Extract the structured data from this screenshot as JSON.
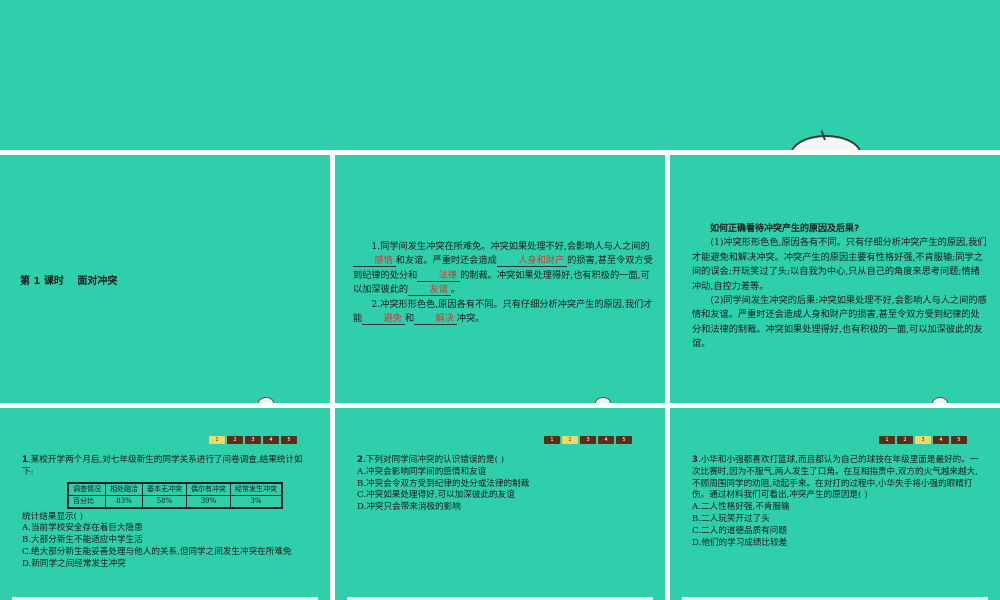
{
  "slide1": {
    "lesson": "第 1 课时",
    "title": "面对冲突"
  },
  "slide2": {
    "p1": {
      "a": "1.同学间发生冲突在所难免。冲突如果处理不好,会影响人与人之间的",
      "b1": "感情",
      "c": "和友谊。严重时还会造成",
      "b2": "人身和财产",
      "d": "的损害,甚至令双方受到纪律的处分和",
      "b3": "法律",
      "e": "的制裁。冲突如果处理得好,也有积极的一面,可以加深彼此的",
      "b4": "友谊",
      "f": "。"
    },
    "p2": {
      "a": "2.冲突形形色色,原因各有不同。只有仔细分析冲突产生的原因,我们才能",
      "b1": "避免",
      "c": "和",
      "b2": "解决",
      "d": "冲突。"
    }
  },
  "slide3": {
    "heading": "如何正确看待冲突产生的原因及后果?",
    "p1": "(1)冲突形形色色,原因各有不同。只有仔细分析冲突产生的原因,我们才能避免和解决冲突。冲突产生的原因主要有性格好强,不肯服输;同学之间的误会;开玩笑过了头;以自我为中心,只从自己的角度来思考问题;情绪冲动,自控力差等。",
    "p2": "(2)同学间发生冲突的后果:冲突如果处理不好,会影响人与人之间的感情和友谊。严重时还会造成人身和财产的损害,甚至令双方受到纪律的处分和法律的制裁。冲突如果处理得好,也有积极的一面,可以加深彼此的友谊。"
  },
  "pager": {
    "labels": [
      "1",
      "2",
      "3",
      "4",
      "5"
    ]
  },
  "q1": {
    "stem_num": "1",
    "stem": ".某校开学两个月后,对七年级新生的同学关系进行了问卷调查,结果统计如下:",
    "table": {
      "header": [
        "调查情况",
        "相处融洽",
        "基本无冲突",
        "偶尔有冲突",
        "经常发生冲突"
      ],
      "row": [
        "百分比",
        "83%",
        "58%",
        "39%",
        "3%"
      ]
    },
    "stem2": "统计结果显示(    )",
    "options": [
      "A.当前学校安全存在着巨大隐患",
      "B.大部分新生不能适应中学生活",
      "C.绝大部分新生能妥善处理与他人的关系,但同学之间发生冲突在所难免",
      "D.新同学之间经常发生冲突"
    ]
  },
  "q2": {
    "stem_num": "2",
    "stem": ".下列对同学间冲突的认识错误的是(    )",
    "options": [
      "A.冲突会影响同学间的感情和友谊",
      "B.冲突会令双方受到纪律的处分或法律的制裁",
      "C.冲突如果处理得好,可以加深彼此的友谊",
      "D.冲突只会带来消极的影响"
    ]
  },
  "q3": {
    "stem_num": "3",
    "stem": ".小华和小强都喜欢打篮球,而且都认为自己的球技在年级里面是最好的。一次比赛时,因为不服气,两人发生了口角。在互相指责中,双方的火气越来越大,不顾周围同学的劝阻,动起手来。在对打的过程中,小华失手将小强的眼睛打伤。通过材料我们可看出,冲突产生的原因是(    )",
    "options": [
      "A.二人性格好强,不肯服输",
      "B.二人玩笑开过了头",
      "C.二人的道德品质有问题",
      "D.他们的学习成绩比较差"
    ]
  },
  "colors": {
    "slide_bg": "#2ecfaa",
    "answer_red": "#d03a2c",
    "pager_dark": "#5a2e15",
    "pager_active": "#f1d86a"
  }
}
